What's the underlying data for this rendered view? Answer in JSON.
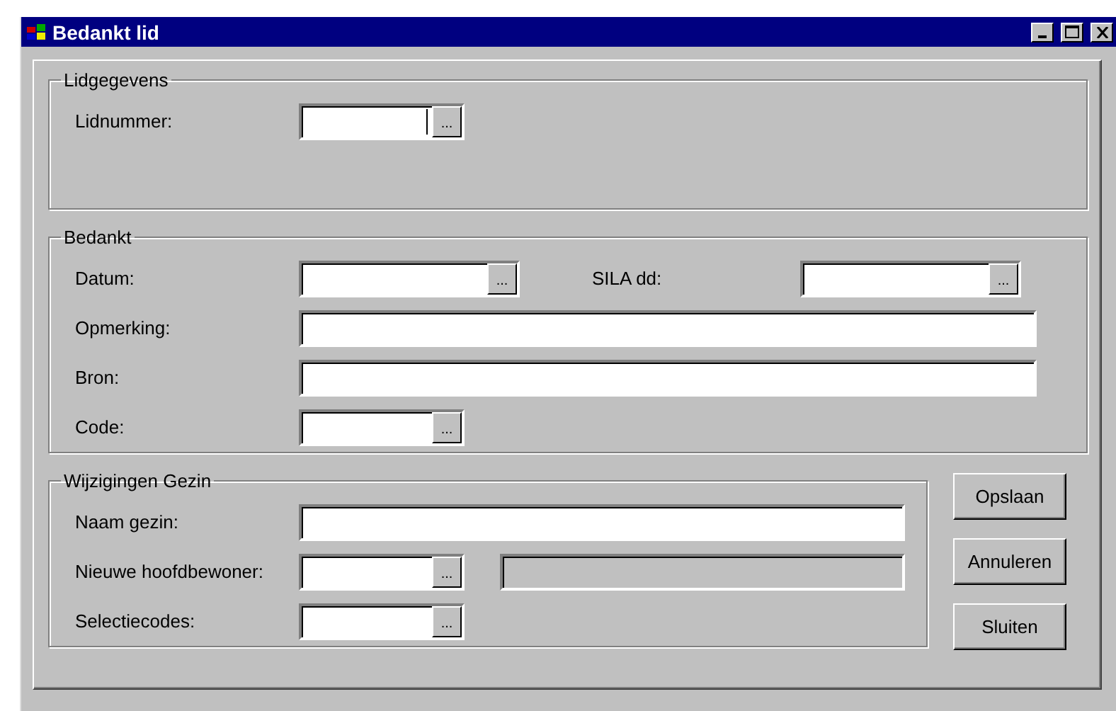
{
  "window": {
    "title": "Bedankt lid"
  },
  "groups": [
    {
      "title": "Lidgegevens",
      "rows": [
        {
          "label": "Lidnummer:",
          "fields": [
            {
              "kind": "lookup",
              "button_label": "...",
              "focused": true
            }
          ]
        }
      ]
    },
    {
      "title": "Bedankt",
      "rows": [
        {
          "label": "Datum:",
          "fields": [
            {
              "kind": "lookup",
              "button_label": "...",
              "focused": false
            },
            {
              "kind": "lookup",
              "label": "SILA dd:",
              "button_label": "...",
              "focused": false
            }
          ]
        },
        {
          "label": "Opmerking:",
          "fields": [
            {
              "kind": "text"
            }
          ]
        },
        {
          "label": "Bron:",
          "fields": [
            {
              "kind": "text"
            }
          ]
        },
        {
          "label": "Code:",
          "fields": [
            {
              "kind": "lookup",
              "button_label": "...",
              "focused": false
            }
          ]
        }
      ]
    },
    {
      "title": "Wijzigingen Gezin",
      "rows": [
        {
          "label": "Naam gezin:",
          "fields": [
            {
              "kind": "text"
            }
          ]
        },
        {
          "label": "Nieuwe hoofdbewoner:",
          "fields": [
            {
              "kind": "lookup",
              "button_label": "...",
              "focused": false
            },
            {
              "kind": "readonly"
            }
          ]
        },
        {
          "label": "Selectiecodes:",
          "fields": [
            {
              "kind": "lookup",
              "button_label": "...",
              "focused": false
            }
          ]
        }
      ]
    }
  ],
  "buttons": [
    "Opslaan",
    "Annuleren",
    "Sluiten"
  ]
}
